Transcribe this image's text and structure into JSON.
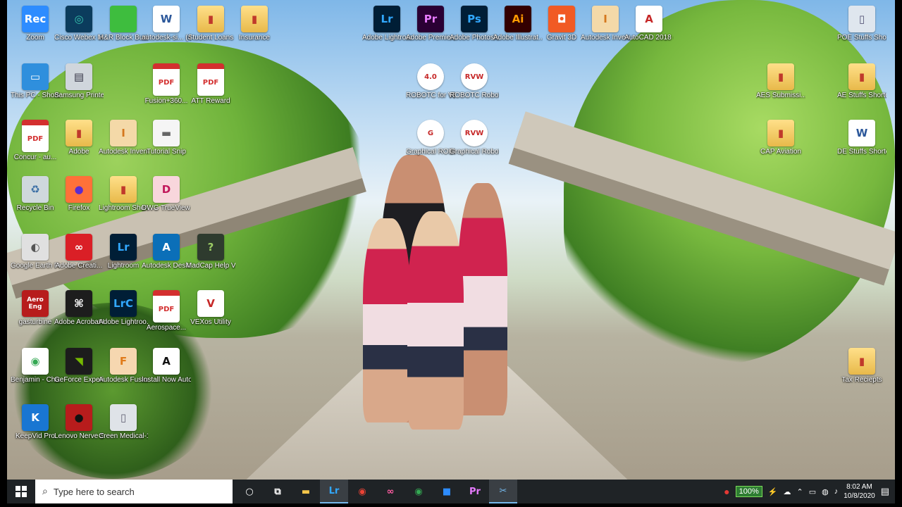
{
  "wallpaper": {
    "description": ""
  },
  "desktop_icons": [
    {
      "id": "zoom",
      "label": "Zoom",
      "glyph": "Rec",
      "icon": "zoom-icon",
      "bg": "#2d8cff",
      "fg": "#ffffff"
    },
    {
      "id": "webex",
      "label": "Cisco Webex Meetings",
      "glyph": "◎",
      "icon": "webex-icon",
      "bg": "#0b3c5d",
      "fg": "#36c5b0"
    },
    {
      "id": "hrblock",
      "label": "H&R Block Business 2019",
      "glyph": "",
      "icon": "hr-block-icon",
      "bg": "#3ebd3e",
      "fg": "#ffffff"
    },
    {
      "id": "autodesk_si",
      "label": "autodesk-si... (4)",
      "glyph": "W",
      "icon": "word-document-icon",
      "cls": "word"
    },
    {
      "id": "student_loans",
      "label": "Student Loans",
      "glyph": "▮",
      "icon": "folder-icon",
      "cls": "folder"
    },
    {
      "id": "insurance",
      "label": "Insurance",
      "glyph": "▮",
      "icon": "folder-icon",
      "cls": "folder"
    },
    {
      "id": "lightroom_top",
      "label": "Adobe Lightroom",
      "glyph": "Lr",
      "icon": "lightroom-icon",
      "bg": "#001e36",
      "fg": "#31a8ff"
    },
    {
      "id": "premiere",
      "label": "Adobe Premiere P...",
      "glyph": "Pr",
      "icon": "premiere-icon",
      "bg": "#2a0034",
      "fg": "#e77bff"
    },
    {
      "id": "photoshop",
      "label": "Adobe Photosh...",
      "glyph": "Ps",
      "icon": "photoshop-icon",
      "bg": "#001e36",
      "fg": "#31a8ff"
    },
    {
      "id": "illustrator",
      "label": "Adobe Illustrat...",
      "glyph": "Ai",
      "icon": "illustrator-icon",
      "bg": "#330000",
      "fg": "#ff9a00"
    },
    {
      "id": "gravit",
      "label": "Gravit 3D",
      "glyph": "◘",
      "icon": "gravit-3d-icon",
      "bg": "#f15a24",
      "fg": "#ffffff"
    },
    {
      "id": "inventor_top",
      "label": "Autodesk Inventor P...",
      "glyph": "I",
      "icon": "inventor-icon",
      "bg": "#f4d9a8",
      "fg": "#d4771d"
    },
    {
      "id": "autocad",
      "label": "AutoCAD 2018 - English",
      "glyph": "A",
      "icon": "autocad-icon",
      "bg": "#ffffff",
      "fg": "#c62828"
    },
    {
      "id": "poe",
      "label": "POE Stuffs Shortcut",
      "glyph": "▯",
      "icon": "shortcut-icon",
      "bg": "#dfe6ee",
      "fg": "#557"
    },
    {
      "id": "this_pc",
      "label": "This PC - Shortcut",
      "glyph": "▭",
      "icon": "computer-icon",
      "bg": "#2f8fdd",
      "fg": "#ffffff"
    },
    {
      "id": "samsung",
      "label": "Samsung Printer Dir",
      "glyph": "▤",
      "icon": "printer-icon",
      "bg": "#d0d6dc",
      "fg": "#334"
    },
    {
      "id": "fusion_pdf",
      "label": "Fusion+360...",
      "glyph": "PDF",
      "icon": "pdf-icon",
      "cls": "pdf"
    },
    {
      "id": "att",
      "label": "ATT Reward",
      "glyph": "PDF",
      "icon": "pdf-icon",
      "cls": "pdf"
    },
    {
      "id": "robotc_vex",
      "label": "ROBOTC for VEX Robotics 4.X",
      "glyph": "4.0",
      "icon": "robotc-icon",
      "cls": "robot"
    },
    {
      "id": "robotc_virtual",
      "label": "ROBOTC Robot Virtu...",
      "glyph": "RVW",
      "icon": "robot-virtual-worlds-icon",
      "cls": "robot"
    },
    {
      "id": "aes",
      "label": "AES Submissi... 2020 Training",
      "glyph": "▮",
      "icon": "folder-icon",
      "cls": "folder"
    },
    {
      "id": "ae_stuffs",
      "label": "AE Stuffs Shortcut",
      "glyph": "▮",
      "icon": "folder-icon",
      "cls": "folder"
    },
    {
      "id": "concur",
      "label": "Concur - au...",
      "glyph": "PDF",
      "icon": "pdf-icon",
      "cls": "pdf"
    },
    {
      "id": "adobe_folder",
      "label": "Adobe",
      "glyph": "▮",
      "icon": "folder-icon",
      "cls": "folder"
    },
    {
      "id": "inventor_pro",
      "label": "Autodesk Inventor P...",
      "glyph": "I",
      "icon": "inventor-icon",
      "bg": "#f4d9a8",
      "fg": "#d4771d"
    },
    {
      "id": "tutorial_snip",
      "label": "Tutorial Snip",
      "glyph": "▬",
      "icon": "snip-icon",
      "bg": "#f5f5f5",
      "fg": "#666"
    },
    {
      "id": "graphical_robotc",
      "label": "Graphical ROBOTC fo...",
      "glyph": "G",
      "icon": "graphical-robotc-icon",
      "cls": "robot"
    },
    {
      "id": "graphical_robot_virtual",
      "label": "Graphical Robot Virtu...",
      "glyph": "RVW",
      "icon": "robot-virtual-worlds-icon",
      "cls": "robot"
    },
    {
      "id": "cap",
      "label": "CAP Aviation",
      "glyph": "▮",
      "icon": "folder-icon",
      "cls": "folder"
    },
    {
      "id": "de_stuffs",
      "label": "DE Stuffs Shortcut",
      "glyph": "W",
      "icon": "word-document-icon",
      "cls": "word"
    },
    {
      "id": "recycle",
      "label": "Recycle Bin",
      "glyph": "♻",
      "icon": "recycle-bin-icon",
      "bg": "#cfd8dc",
      "fg": "#3a6ea5"
    },
    {
      "id": "firefox",
      "label": "Firefox",
      "glyph": "●",
      "icon": "firefox-icon",
      "bg": "#ff7139",
      "fg": "#5b2ccf"
    },
    {
      "id": "lightroom_shortcut",
      "label": "Lightroom Shortcut",
      "glyph": "▮",
      "icon": "folder-icon",
      "cls": "folder"
    },
    {
      "id": "dwg",
      "label": "DWG TrueView 20...",
      "glyph": "D",
      "icon": "dwg-trueview-icon",
      "bg": "#f8d6dc",
      "fg": "#c2185b"
    },
    {
      "id": "google_earth",
      "label": "Google Earth Pro",
      "glyph": "◐",
      "icon": "google-earth-icon",
      "bg": "#e0e0e0",
      "fg": "#555"
    },
    {
      "id": "creative_cloud",
      "label": "Adobe Creati...",
      "glyph": "∞",
      "icon": "creative-cloud-icon",
      "bg": "#da1f26",
      "fg": "#ffffff"
    },
    {
      "id": "lightroom_classic",
      "label": "Lightroom",
      "glyph": "Lr",
      "icon": "lightroom-icon",
      "bg": "#001e36",
      "fg": "#31a8ff"
    },
    {
      "id": "desktop_app",
      "label": "Autodesk Desktop App",
      "glyph": "A",
      "icon": "autodesk-desktop-app-icon",
      "bg": "#0b6fb8",
      "fg": "#ffffff"
    },
    {
      "id": "madcap",
      "label": "MadCap Help Viewer",
      "glyph": "?",
      "icon": "madcap-icon",
      "bg": "#2e3b2e",
      "fg": "#9ccc65"
    },
    {
      "id": "aero",
      "label": "gasturbine",
      "glyph": "Aero Eng",
      "icon": "aero-eng-icon",
      "bg": "#b71c1c",
      "fg": "#ffffff"
    },
    {
      "id": "acrobat",
      "label": "Adobe Acrobat DC",
      "glyph": "⌘",
      "icon": "acrobat-icon",
      "bg": "#1d1d1d",
      "fg": "#ffffff"
    },
    {
      "id": "lrc",
      "label": "Adobe Lightroo...",
      "glyph": "LrC",
      "icon": "lightroom-classic-icon",
      "bg": "#001e36",
      "fg": "#31a8ff"
    },
    {
      "id": "aerospace",
      "label": "Aerospace...",
      "glyph": "PDF",
      "icon": "pdf-icon",
      "cls": "pdf"
    },
    {
      "id": "vexos",
      "label": "VEXos Utility",
      "glyph": "V",
      "icon": "vexos-icon",
      "bg": "#ffffff",
      "fg": "#c62828"
    },
    {
      "id": "chrome_benjamin",
      "label": "Benjamin - Chrome",
      "glyph": "◉",
      "icon": "chrome-icon",
      "bg": "#ffffff",
      "fg": "#34a853"
    },
    {
      "id": "geforce",
      "label": "GeForce Experience",
      "glyph": "◥",
      "icon": "geforce-icon",
      "bg": "#1c1c1c",
      "fg": "#76b900"
    },
    {
      "id": "fusion360",
      "label": "Autodesk Fusion 360",
      "glyph": "F",
      "icon": "fusion-360-icon",
      "bg": "#f6d7b0",
      "fg": "#e07b1a"
    },
    {
      "id": "install_now",
      "label": "Install Now Autodesk In...",
      "glyph": "A",
      "icon": "autodesk-install-icon",
      "bg": "#ffffff",
      "fg": "#111111"
    },
    {
      "id": "tax",
      "label": "Tax Reciepts",
      "glyph": "▮",
      "icon": "folder-icon",
      "cls": "folder"
    },
    {
      "id": "keepvid",
      "label": "KeepVid Pro",
      "glyph": "K",
      "icon": "keepvid-icon",
      "bg": "#1976d2",
      "fg": "#ffffff"
    },
    {
      "id": "nerve",
      "label": "Lenovo Nerve Sense",
      "glyph": "●",
      "icon": "lenovo-nerve-sense-icon",
      "bg": "#b71c1c",
      "fg": "#111"
    },
    {
      "id": "creen",
      "label": "Creen Medical-1",
      "glyph": "▯",
      "icon": "document-icon",
      "bg": "#dfe3e8",
      "fg": "#667"
    }
  ],
  "taskbar": {
    "search_placeholder": "Type here to search",
    "apps": [
      {
        "id": "cortana",
        "glyph": "○",
        "icon": "cortana-icon"
      },
      {
        "id": "taskview",
        "glyph": "⧉",
        "icon": "task-view-icon"
      },
      {
        "id": "explorer",
        "glyph": "▬",
        "icon": "file-explorer-icon",
        "color": "#f3c54a"
      },
      {
        "id": "lightroom",
        "glyph": "Lr",
        "icon": "lightroom-icon",
        "color": "#31a8ff",
        "active": true
      },
      {
        "id": "chrome",
        "glyph": "◉",
        "icon": "chrome-icon",
        "color": "#ea4335"
      },
      {
        "id": "creative_cloud",
        "glyph": "∞",
        "icon": "creative-cloud-icon",
        "color": "#ff5da2"
      },
      {
        "id": "chrome2",
        "glyph": "◉",
        "icon": "chrome-icon",
        "color": "#34a853"
      },
      {
        "id": "zoom",
        "glyph": "■",
        "icon": "zoom-icon",
        "color": "#2d8cff"
      },
      {
        "id": "premiere",
        "glyph": "Pr",
        "icon": "premiere-icon",
        "color": "#e77bff"
      },
      {
        "id": "snip",
        "glyph": "✂",
        "icon": "snip-sketch-icon",
        "color": "#76b9ed",
        "active": true
      }
    ],
    "battery_percent": "100%",
    "time": "8:02 AM",
    "date": "10/8/2020"
  }
}
